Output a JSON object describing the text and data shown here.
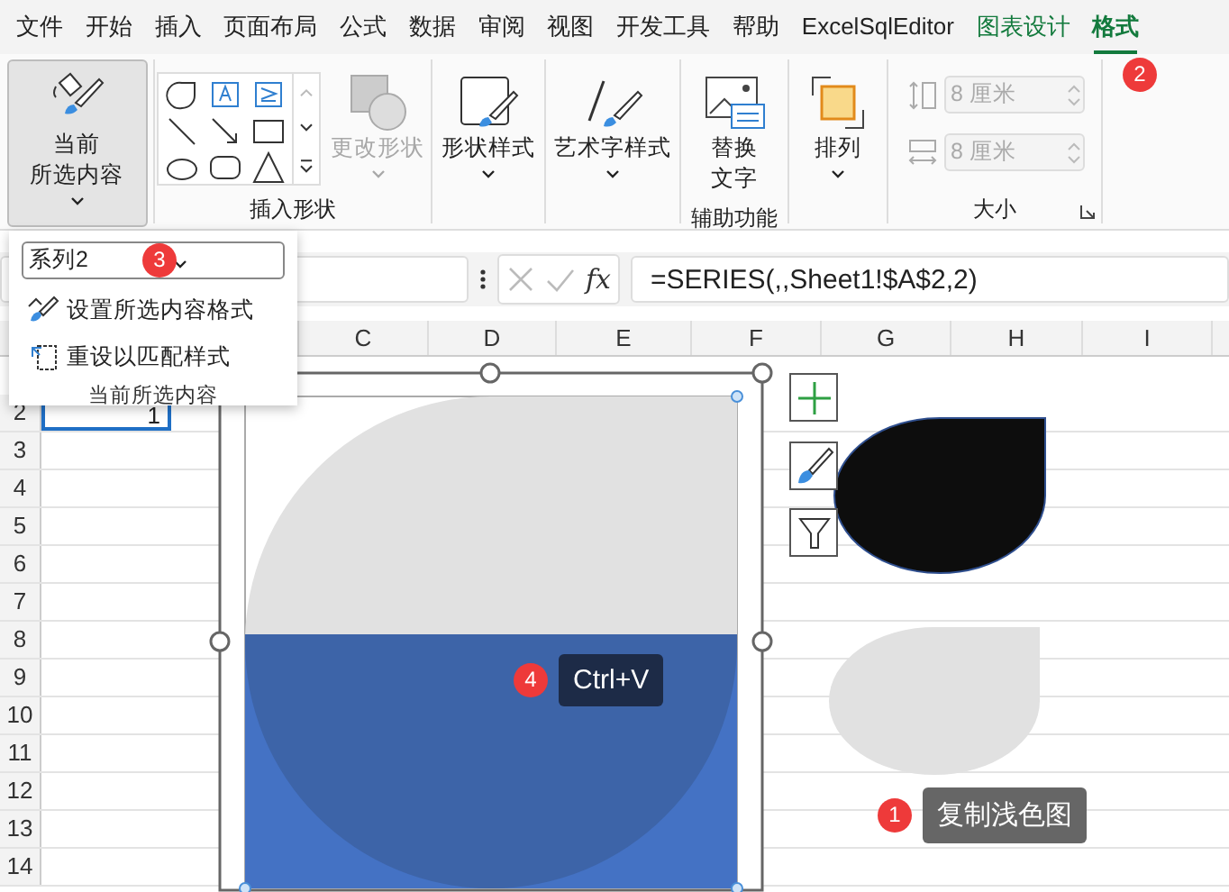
{
  "tabs": [
    {
      "label": "文件",
      "kind": "normal",
      "selected": false
    },
    {
      "label": "开始",
      "kind": "normal",
      "selected": false
    },
    {
      "label": "插入",
      "kind": "normal",
      "selected": false
    },
    {
      "label": "页面布局",
      "kind": "normal",
      "selected": false
    },
    {
      "label": "公式",
      "kind": "normal",
      "selected": false
    },
    {
      "label": "数据",
      "kind": "normal",
      "selected": false
    },
    {
      "label": "审阅",
      "kind": "normal",
      "selected": false
    },
    {
      "label": "视图",
      "kind": "normal",
      "selected": false
    },
    {
      "label": "开发工具",
      "kind": "normal",
      "selected": false
    },
    {
      "label": "帮助",
      "kind": "normal",
      "selected": false
    },
    {
      "label": "ExcelSqlEditor",
      "kind": "normal",
      "selected": false
    },
    {
      "label": "图表设计",
      "kind": "contextual",
      "selected": false
    },
    {
      "label": "格式",
      "kind": "contextual",
      "selected": true,
      "badge": "2"
    }
  ],
  "ribbon": [
    {
      "items": [
        {
          "kind": "big",
          "lines": [
            "当前",
            "所选内容"
          ],
          "caret": true,
          "pressed": true,
          "disabled": false
        }
      ]
    },
    {
      "label": "插入形状",
      "items": [
        {
          "kind": "gallery"
        },
        {
          "kind": "big",
          "lines": [
            "更改形状"
          ],
          "caret": true,
          "pressed": false,
          "disabled": true
        }
      ]
    },
    {
      "items": [
        {
          "kind": "big",
          "lines": [
            "形状样式"
          ],
          "caret": true,
          "pressed": false,
          "disabled": false
        }
      ]
    },
    {
      "items": [
        {
          "kind": "big",
          "lines": [
            "艺术字样式"
          ],
          "caret": true,
          "pressed": false,
          "disabled": false
        }
      ]
    },
    {
      "label": "辅助功能",
      "items": [
        {
          "kind": "big",
          "lines": [
            "替换",
            "文字"
          ],
          "caret": false,
          "pressed": false,
          "disabled": false
        }
      ]
    },
    {
      "items": [
        {
          "kind": "big",
          "lines": [
            "排列"
          ],
          "caret": true,
          "pressed": false,
          "disabled": false
        }
      ]
    },
    {
      "label": "大小",
      "launcher": true,
      "items": [
        {
          "kind": "spin",
          "value": "8 厘米",
          "disabled": true
        },
        {
          "kind": "spin",
          "value": "8 厘米",
          "disabled": true
        }
      ]
    }
  ],
  "selection_dropdown": {
    "value": "系列2",
    "badge": "3",
    "items": [
      "设置所选内容格式",
      "重设以匹配样式"
    ],
    "footer": "当前所选内容"
  },
  "formula_bar": {
    "function_button": "fx",
    "formula": "=SERIES(,,Sheet1!$A$2,2)"
  },
  "sheet": {
    "columns": [
      "C",
      "D",
      "E",
      "F",
      "G",
      "H",
      "I"
    ],
    "rows": [
      "2",
      "3",
      "4",
      "5",
      "6",
      "7",
      "8",
      "9",
      "10",
      "11",
      "12",
      "13",
      "14"
    ],
    "cell_a2": {
      "value": "1",
      "selected": true
    }
  },
  "callouts": [
    {
      "badge": "4",
      "text": "Ctrl+V",
      "kind": "dark"
    },
    {
      "badge": "1",
      "text": "复制浅色图",
      "kind": "grey"
    }
  ]
}
